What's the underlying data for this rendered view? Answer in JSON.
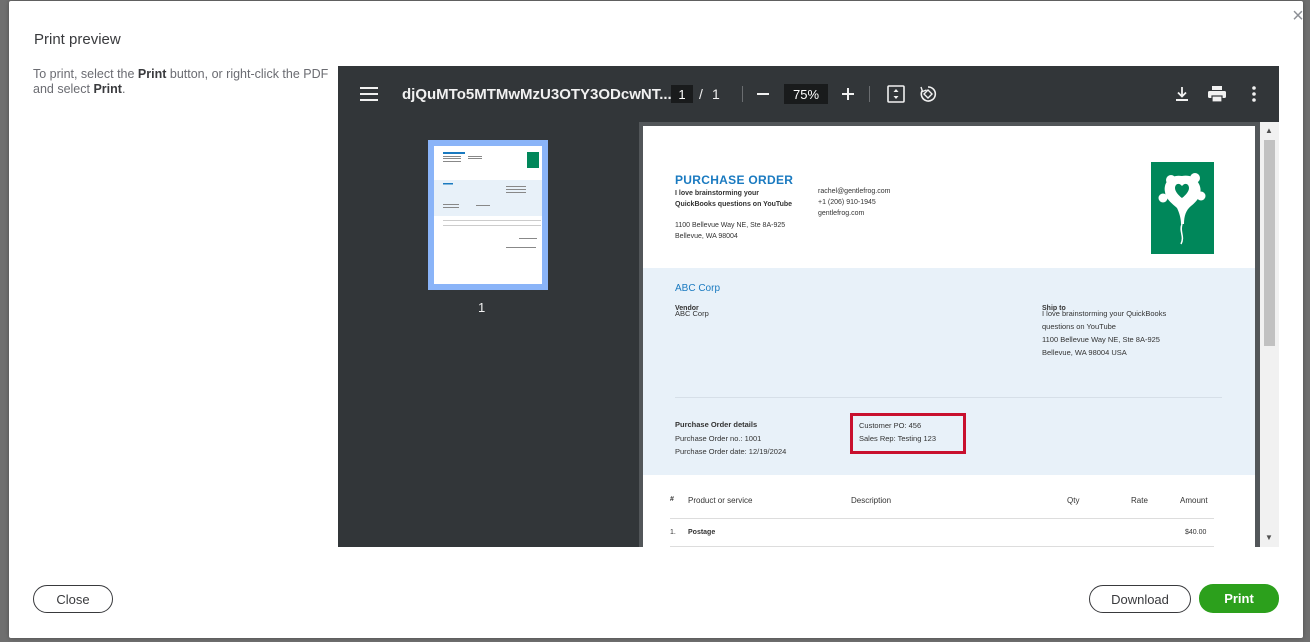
{
  "dialog": {
    "title": "Print preview",
    "close_icon": "×",
    "instructions": {
      "part1": "To print, select the ",
      "bold1": "Print",
      "part2": " button, or right-click the PDF and select ",
      "bold2": "Print",
      "part3": "."
    }
  },
  "viewer": {
    "doc_title": "djQuMTo5MTMwMzU3OTY3ODcwNT...",
    "current_page": "1",
    "page_separator": "/",
    "total_pages": "1",
    "zoom": "75%",
    "thumbnail_label": "1"
  },
  "document": {
    "title": "PURCHASE ORDER",
    "company_name": "I love brainstorming your QuickBooks questions on YouTube",
    "company_address_line1": "1100 Bellevue Way NE, Ste 8A-925",
    "company_address_line2": "Bellevue, WA 98004",
    "email": "rachel@gentlefrog.com",
    "phone": "+1 (206) 910-1945",
    "website": "gentlefrog.com",
    "vendor_display": "ABC Corp",
    "vendor_label": "Vendor",
    "vendor_name": "ABC Corp",
    "ship_to_label": "Ship to",
    "ship_to_line1": "I love brainstorming your QuickBooks",
    "ship_to_line2": "questions on YouTube",
    "ship_to_line3": "1100 Bellevue Way NE, Ste 8A-925",
    "ship_to_line4": "Bellevue, WA 98004 USA",
    "details_label": "Purchase Order details",
    "po_number": "Purchase Order no.: 1001",
    "po_date": "Purchase Order date: 12/19/2024",
    "customer_po": "Customer PO: 456",
    "sales_rep": "Sales Rep: Testing 123",
    "table_headers": {
      "num": "#",
      "product": "Product or service",
      "description": "Description",
      "qty": "Qty",
      "rate": "Rate",
      "amount": "Amount"
    },
    "rows": [
      {
        "num": "1.",
        "product": "Postage",
        "amount": "$40.00"
      }
    ]
  },
  "footer": {
    "close_label": "Close",
    "download_label": "Download",
    "print_label": "Print"
  },
  "colors": {
    "print_button": "#2ca01c",
    "highlight_border": "#c8102e",
    "doc_accent": "#1a7ac0",
    "logo_green": "#00875a"
  }
}
